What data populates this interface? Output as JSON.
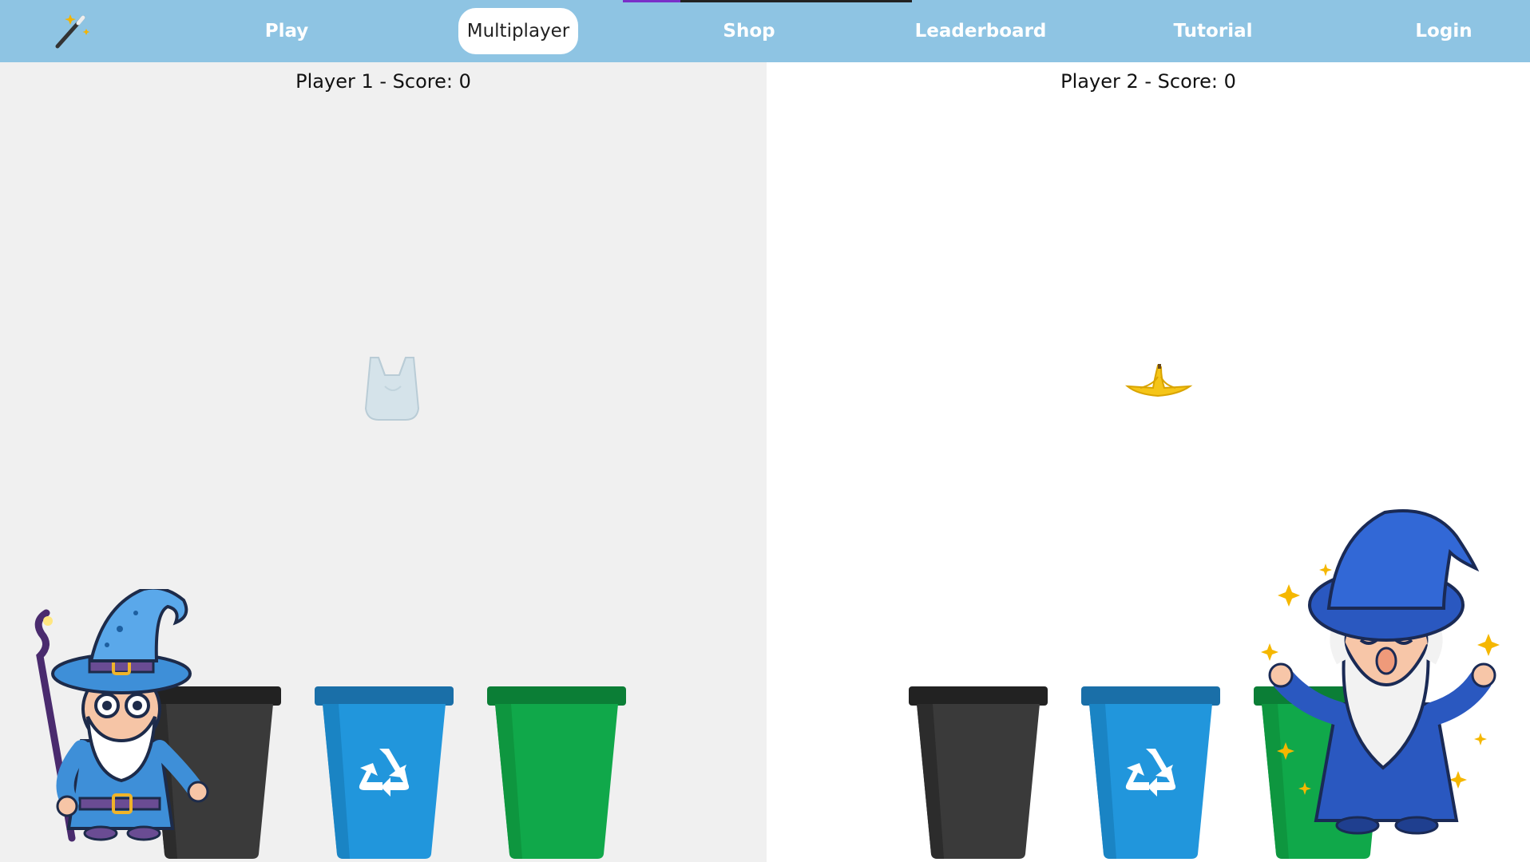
{
  "nav": {
    "progress": 0.2,
    "logo_icon": "magic-wand-icon",
    "items": [
      {
        "label": "Play",
        "active": false
      },
      {
        "label": "Multiplayer",
        "active": true
      },
      {
        "label": "Shop",
        "active": false
      },
      {
        "label": "Leaderboard",
        "active": false
      },
      {
        "label": "Tutorial",
        "active": false
      },
      {
        "label": "Login",
        "active": false
      }
    ]
  },
  "player1": {
    "score_text": "Player 1 - Score: 0",
    "falling_item": "plastic-bag-icon",
    "bins": [
      "black-trash-bin",
      "blue-recycling-bin",
      "green-compost-bin"
    ],
    "character": "wizard-with-staff"
  },
  "player2": {
    "score_text": "Player 2 - Score: 0",
    "falling_item": "banana-peel-icon",
    "bins": [
      "black-trash-bin",
      "blue-recycling-bin",
      "green-compost-bin"
    ],
    "character": "wizard-arms-raised"
  },
  "colors": {
    "nav_bg": "#8ec4e3",
    "left_panel_bg": "#f0f0f0",
    "bin_black": "#3a3a3a",
    "bin_blue": "#2196dc",
    "bin_green": "#10a84a"
  }
}
